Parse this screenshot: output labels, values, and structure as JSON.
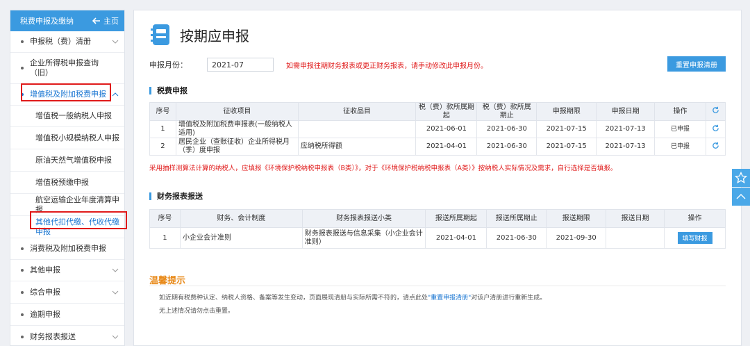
{
  "sidebar": {
    "header": "税费申报及缴纳",
    "home": "主页",
    "items": [
      {
        "label": "申报税（费）清册"
      },
      {
        "label": "企业所得税申报查询（旧）"
      },
      {
        "label": "增值税及附加税费申报"
      },
      {
        "label": "消费税及附加税费申报"
      },
      {
        "label": "其他申报"
      },
      {
        "label": "综合申报"
      },
      {
        "label": "逾期申报"
      },
      {
        "label": "财务报表报送"
      }
    ],
    "subitems": [
      {
        "label": "增值税一般纳税人申报"
      },
      {
        "label": "增值税小规模纳税人申报"
      },
      {
        "label": "原油天然气增值税申报"
      },
      {
        "label": "增值税预缴申报"
      },
      {
        "label": "航空运输企业年度清算申报"
      },
      {
        "label": "其他代扣代缴、代收代缴申报"
      }
    ]
  },
  "page": {
    "title": "按期应申报",
    "month_label": "申报月份：",
    "month_value": "2021-07",
    "month_tip": "如需申报往期财务报表或更正财务报表，请手动修改此申报月份。",
    "reset_button": "重置申报清册"
  },
  "tax_section": {
    "title": "税费申报",
    "headers": [
      "序号",
      "征收项目",
      "征收品目",
      "税（费）款所属期起",
      "税（费）款所属期止",
      "申报期限",
      "申报日期",
      "操作"
    ],
    "rows": [
      {
        "no": "1",
        "item": "增值税及附加税费申报表(一般纳税人适用)",
        "category": "",
        "start": "2021-06-01",
        "end": "2021-06-30",
        "deadline": "2021-07-15",
        "date": "2021-07-13",
        "op": "已申报"
      },
      {
        "no": "2",
        "item": "居民企业（查账征收）企业所得税月（季）度申报",
        "category": "应纳税所得额",
        "start": "2021-04-01",
        "end": "2021-06-30",
        "deadline": "2021-07-15",
        "date": "2021-07-13",
        "op": "已申报"
      }
    ]
  },
  "notice": "采用抽样测算法计算的纳税人，应填报《环境保护税纳税申报表（B类）》，对于《环境保护税纳税申报表（A类）》按纳税人实际情况及需求，自行选择是否填报。",
  "finance_section": {
    "title": "财务报表报送",
    "headers": [
      "序号",
      "财务、会计制度",
      "财务报表报送小类",
      "报送所属期起",
      "报送所属期止",
      "报送期限",
      "报送日期",
      "操作"
    ],
    "rows": [
      {
        "no": "1",
        "system": "小企业会计准则",
        "category": "财务报表报送与信息采集（小企业会计准则）",
        "start": "2021-04-01",
        "end": "2021-06-30",
        "deadline": "2021-09-30",
        "date": "",
        "op": "填写财报"
      }
    ]
  },
  "tips": {
    "title": "温馨提示",
    "line1_a": "如近期有税费种认定、纳税人资格、备案等发生变动，页面展现清册与实际所需不符的，请点此处",
    "line1_link": "\"重置申报清册\"",
    "line1_b": "对该户清册进行重新生成。",
    "line2": "无上述情况请勿点击重置。"
  },
  "colors": {
    "accent": "#3b9ae0",
    "warning": "#e01b1b",
    "tip_title": "#e88a1a"
  }
}
